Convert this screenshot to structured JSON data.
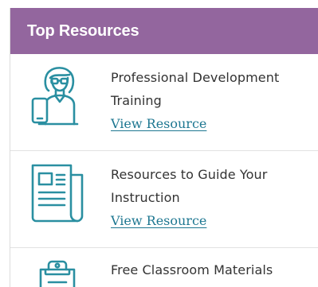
{
  "panel": {
    "title": "Top Resources",
    "header_color": "#93669e",
    "link_color": "#1e7791",
    "icon_color": "#2a8fa1"
  },
  "resources": [
    {
      "title": "Professional Development Training",
      "link": "View Resource",
      "icon": "teacher-with-tablet-icon"
    },
    {
      "title": "Resources to Guide Your Instruction",
      "link": "View Resource",
      "icon": "newspaper-document-icon"
    },
    {
      "title": "Free Classroom Materials",
      "icon": "clipboard-icon"
    }
  ]
}
